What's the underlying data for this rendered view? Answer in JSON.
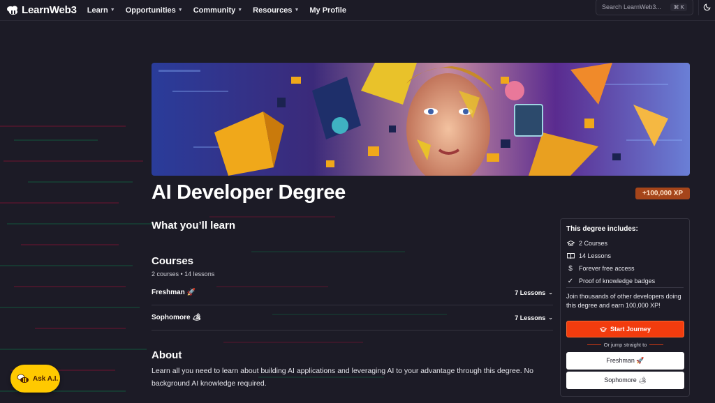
{
  "nav": {
    "logo_text": "LearnWeb3",
    "items": [
      {
        "label": "Learn",
        "has_dropdown": true
      },
      {
        "label": "Opportunities",
        "has_dropdown": true
      },
      {
        "label": "Community",
        "has_dropdown": true
      },
      {
        "label": "Resources",
        "has_dropdown": true
      },
      {
        "label": "My Profile",
        "has_dropdown": false
      }
    ],
    "search_placeholder": "Search LearnWeb3...",
    "search_shortcut": "⌘ K",
    "theme_icon": "moon-icon"
  },
  "hero": {
    "image": "ai-developer-hero-artwork"
  },
  "degree": {
    "title": "AI Developer Degree",
    "xp_badge": "+100,000 XP"
  },
  "learn": {
    "heading": "What you’ll learn"
  },
  "courses": {
    "heading": "Courses",
    "meta": "2 courses • 14 lessons",
    "items": [
      {
        "name": "Freshman 🚀",
        "lessons": "7 Lessons"
      },
      {
        "name": "Sophomore 🏕",
        "lessons": "7 Lessons"
      }
    ]
  },
  "about": {
    "heading": "About",
    "text": "Learn all you need to learn about building AI applications and leveraging AI to your advantage through this degree. No background AI knowledge required."
  },
  "sidebar": {
    "title": "This degree includes:",
    "items": [
      {
        "icon": "graduation-cap-icon",
        "label": "2 Courses"
      },
      {
        "icon": "book-icon",
        "label": "14 Lessons"
      },
      {
        "icon": "dollar-icon",
        "label": "Forever free access"
      },
      {
        "icon": "check-icon",
        "label": "Proof of knowledge badges"
      }
    ],
    "join_text": "Join thousands of other developers doing this degree and earn 100,000 XP!",
    "start_label": "Start Journey",
    "or_jump": "Or jump straight to",
    "jump_buttons": [
      {
        "label": "Freshman 🚀"
      },
      {
        "label": "Sophomore 🏕"
      }
    ]
  },
  "ask_ai": {
    "label": "Ask A.I."
  },
  "colors": {
    "background": "#1c1b26",
    "accent": "#f23c0e",
    "xp_badge": "#a5451a",
    "ask_ai": "#ffc900"
  }
}
